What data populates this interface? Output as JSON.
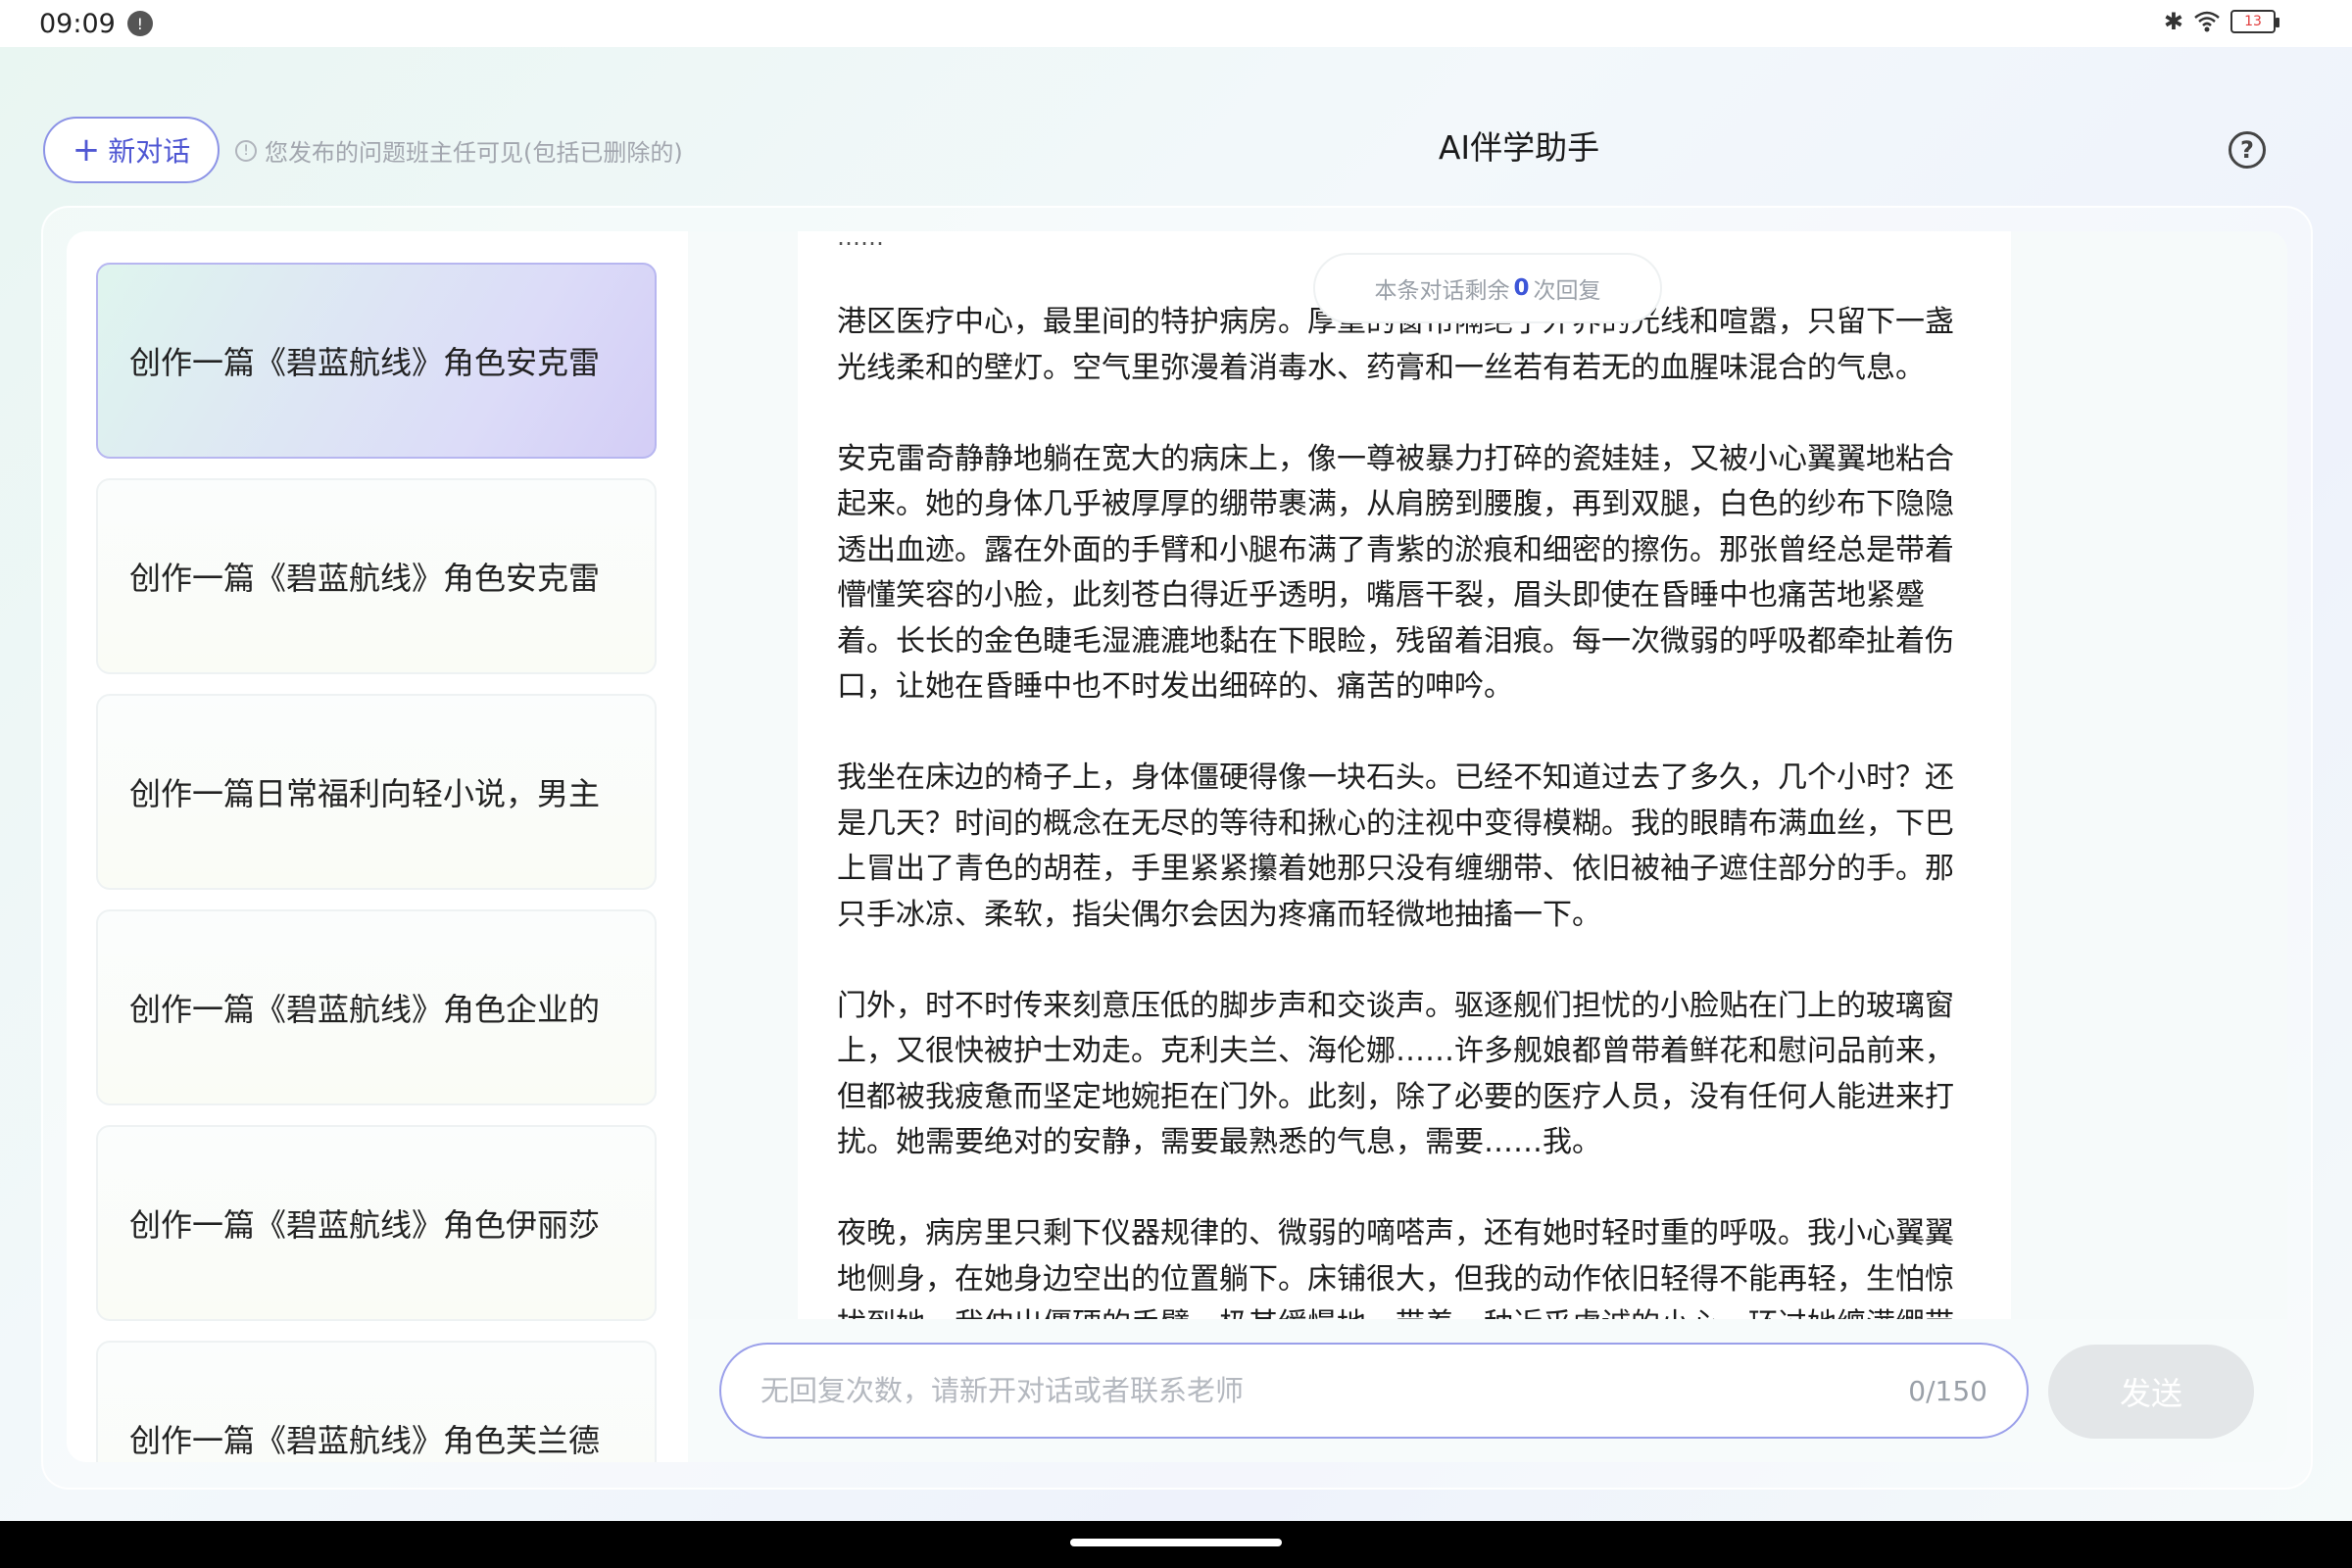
{
  "status_bar": {
    "time": "09:09",
    "notification_count": "!",
    "battery_level": "13",
    "icons": [
      "bluetooth-icon",
      "wifi-icon",
      "battery-icon"
    ]
  },
  "header": {
    "new_chat_label": "新对话",
    "notice": "您发布的问题班主任可见(包括已删除的)",
    "title": "AI伴学助手",
    "help_symbol": "?"
  },
  "sidebar": {
    "items": [
      {
        "label": "创作一篇《碧蓝航线》角色安克雷",
        "active": true
      },
      {
        "label": "创作一篇《碧蓝航线》角色安克雷",
        "active": false
      },
      {
        "label": "创作一篇日常福利向轻小说，男主",
        "active": false
      },
      {
        "label": "创作一篇《碧蓝航线》角色企业的",
        "active": false
      },
      {
        "label": "创作一篇《碧蓝航线》角色伊丽莎",
        "active": false
      },
      {
        "label": "创作一篇《碧蓝航线》角色芙兰德",
        "active": false
      }
    ]
  },
  "chat": {
    "remaining_prefix": "本条对话剩余",
    "remaining_count": "0",
    "remaining_suffix": "次回复",
    "ellipsis": "……",
    "paragraphs": [
      "港区医疗中心，最里间的特护病房。厚重的窗帘隔绝了外界的光线和喧嚣，只留下一盏光线柔和的壁灯。空气里弥漫着消毒水、药膏和一丝若有若无的血腥味混合的气息。",
      "安克雷奇静静地躺在宽大的病床上，像一尊被暴力打碎的瓷娃娃，又被小心翼翼地粘合起来。她的身体几乎被厚厚的绷带裹满，从肩膀到腰腹，再到双腿，白色的纱布下隐隐透出血迹。露在外面的手臂和小腿布满了青紫的淤痕和细密的擦伤。那张曾经总是带着懵懂笑容的小脸，此刻苍白得近乎透明，嘴唇干裂，眉头即使在昏睡中也痛苦地紧蹙着。长长的金色睫毛湿漉漉地黏在下眼睑，残留着泪痕。每一次微弱的呼吸都牵扯着伤口，让她在昏睡中也不时发出细碎的、痛苦的呻吟。",
      "我坐在床边的椅子上，身体僵硬得像一块石头。已经不知道过去了多久，几个小时？还是几天？时间的概念在无尽的等待和揪心的注视中变得模糊。我的眼睛布满血丝，下巴上冒出了青色的胡茬，手里紧紧攥着她那只没有缠绷带、依旧被袖子遮住部分的手。那只手冰凉、柔软，指尖偶尔会因为疼痛而轻微地抽搐一下。",
      "门外，时不时传来刻意压低的脚步声和交谈声。驱逐舰们担忧的小脸贴在门上的玻璃窗上，又很快被护士劝走。克利夫兰、海伦娜……许多舰娘都曾带着鲜花和慰问品前来，但都被我疲惫而坚定地婉拒在门外。此刻，除了必要的医疗人员，没有任何人能进来打扰。她需要绝对的安静，需要最熟悉的气息，需要……我。",
      "夜晚，病房里只剩下仪器规律的、微弱的嘀嗒声，还有她时轻时重的呼吸。我小心翼翼地侧身，在她身边空出的位置躺下。床铺很大，但我的动作依旧轻得不能再轻，生怕惊扰到她。我伸出僵硬的手臂，极其缓慢地，带着一种近乎虔诚的小心，环过她缠满绷带的身体。"
    ]
  },
  "input": {
    "placeholder": "无回复次数，请新开对话或者联系老师",
    "value": "",
    "char_count": "0/150",
    "send_label": "发送"
  }
}
